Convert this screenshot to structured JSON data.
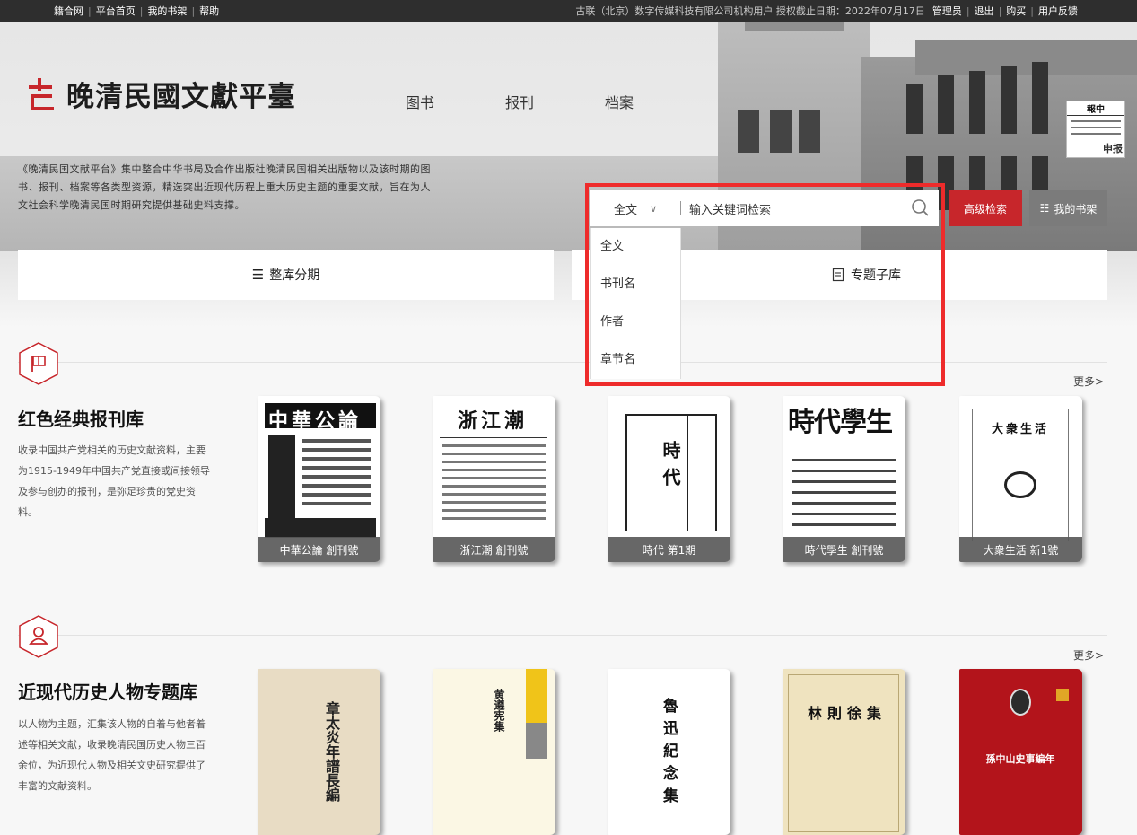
{
  "topbar": {
    "links": [
      "籍合网",
      "平台首页",
      "我的书架",
      "帮助"
    ],
    "info": "古联（北京）数字传媒科技有限公司机构用户 授权截止日期：2022年07月17日",
    "user_links": [
      "管理员",
      "退出",
      "购买",
      "用户反馈"
    ]
  },
  "site": {
    "logo_text": "晚清民國文獻平臺"
  },
  "nav": [
    "图书",
    "报刊",
    "档案"
  ],
  "intro": "《晚清民国文献平台》集中整合中华书局及合作出版社晚清民国相关出版物以及该时期的图书、报刊、档案等各类型资源，精选突出近现代历程上重大历史主题的重要文献，旨在为人文社会科学晚清民国时期研究提供基础史料支撑。",
  "news_thumb": {
    "head": "報中",
    "tag": "申报"
  },
  "search": {
    "scope_selected": "全文",
    "placeholder": "输入关键词检索",
    "options": [
      "全文",
      "书刊名",
      "作者",
      "章节名"
    ],
    "advanced_label": "高级检索",
    "shelf_label": "我的书架"
  },
  "tabs": [
    {
      "label": "整库分期",
      "icon": "list-icon"
    },
    {
      "label": "专题子库",
      "icon": "document-icon"
    }
  ],
  "sections": [
    {
      "title": "红色经典报刊库",
      "icon": "flag-icon",
      "desc": "收录中国共产党相关的历史文献资料，主要为1915-1949年中国共产党直接或间接领导及参与创办的报刊，是弥足珍贵的党史资料。",
      "more": "更多>",
      "books": [
        {
          "caption": "中華公論 創刊號",
          "cover_text": "中華公論"
        },
        {
          "caption": "浙江潮 創刊號",
          "cover_text": "浙江潮"
        },
        {
          "caption": "時代 第1期",
          "cover_text": "時代"
        },
        {
          "caption": "時代學生 創刊號",
          "cover_text": "時代學生"
        },
        {
          "caption": "大衆生活 新1號",
          "cover_text": "大衆生活"
        }
      ]
    },
    {
      "title": "近现代历史人物专题库",
      "icon": "person-icon",
      "desc": "以人物为主题，汇集该人物的自着与他者着述等相关文献，收录晚清民国历史人物三百余位，为近现代人物及相关文史研究提供了丰富的文献资料。",
      "more": "更多>",
      "books": [
        {
          "cover_text": "章太炎年譜長編"
        },
        {
          "cover_text": "黄遵宪集"
        },
        {
          "cover_text": "魯迅紀念集"
        },
        {
          "cover_text": "林則徐集"
        },
        {
          "cover_text": "孫中山史事編年"
        }
      ]
    }
  ],
  "colors": {
    "accent_red": "#c7262b",
    "topbar": "#2e2e2e",
    "highlight": "#ee2b2b"
  }
}
